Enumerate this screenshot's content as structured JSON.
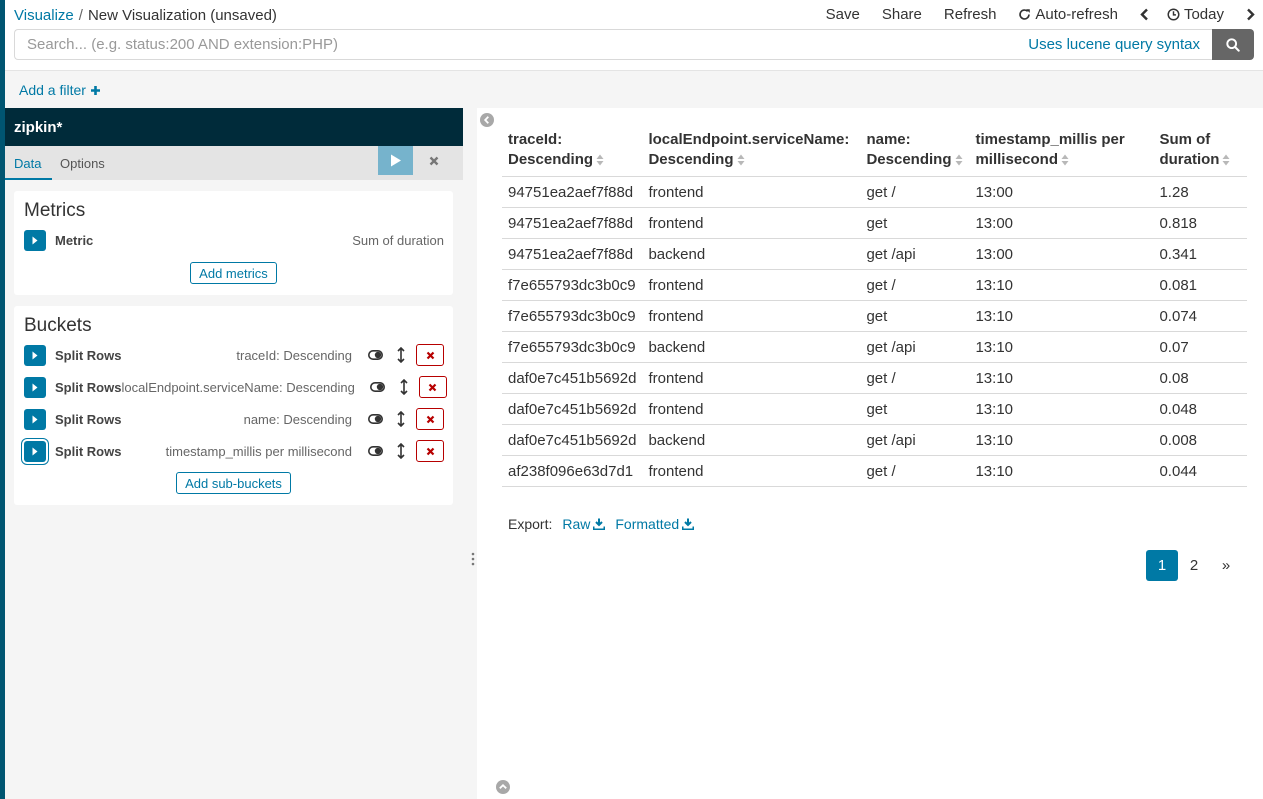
{
  "breadcrumb": {
    "root": "Visualize",
    "separator": "/",
    "current": "New Visualization (unsaved)"
  },
  "nav": {
    "save": "Save",
    "share": "Share",
    "refresh": "Refresh",
    "auto_refresh": "Auto-refresh",
    "time": "Today"
  },
  "search": {
    "placeholder": "Search... (e.g. status:200 AND extension:PHP)",
    "value": "",
    "lucene_link": "Uses lucene query syntax"
  },
  "filter": {
    "add_label": "Add a filter"
  },
  "index_pattern": "zipkin*",
  "tabs": {
    "data": "Data",
    "options": "Options"
  },
  "metrics": {
    "title": "Metrics",
    "items": [
      {
        "type": "Metric",
        "desc": "Sum of duration"
      }
    ],
    "add_label": "Add metrics"
  },
  "buckets": {
    "title": "Buckets",
    "items": [
      {
        "type": "Split Rows",
        "desc": "traceId: Descending"
      },
      {
        "type": "Split Rows",
        "desc": "localEndpoint.serviceName: Descending"
      },
      {
        "type": "Split Rows",
        "desc": "name: Descending"
      },
      {
        "type": "Split Rows",
        "desc": "timestamp_millis per millisecond"
      }
    ],
    "add_label": "Add sub-buckets"
  },
  "table": {
    "headers": [
      [
        "traceId:",
        "Descending"
      ],
      [
        "localEndpoint.serviceName:",
        "Descending"
      ],
      [
        "name:",
        "Descending"
      ],
      [
        "timestamp_millis per",
        "millisecond"
      ],
      [
        "Sum of",
        "duration"
      ]
    ],
    "rows": [
      [
        "94751ea2aef7f88d",
        "frontend",
        "get /",
        "13:00",
        "1.28"
      ],
      [
        "94751ea2aef7f88d",
        "frontend",
        "get",
        "13:00",
        "0.818"
      ],
      [
        "94751ea2aef7f88d",
        "backend",
        "get /api",
        "13:00",
        "0.341"
      ],
      [
        "f7e655793dc3b0c9",
        "frontend",
        "get /",
        "13:10",
        "0.081"
      ],
      [
        "f7e655793dc3b0c9",
        "frontend",
        "get",
        "13:10",
        "0.074"
      ],
      [
        "f7e655793dc3b0c9",
        "backend",
        "get /api",
        "13:10",
        "0.07"
      ],
      [
        "daf0e7c451b5692d",
        "frontend",
        "get /",
        "13:10",
        "0.08"
      ],
      [
        "daf0e7c451b5692d",
        "frontend",
        "get",
        "13:10",
        "0.048"
      ],
      [
        "daf0e7c451b5692d",
        "backend",
        "get /api",
        "13:10",
        "0.008"
      ],
      [
        "af238f096e63d7d1",
        "frontend",
        "get /",
        "13:10",
        "0.044"
      ]
    ]
  },
  "export": {
    "label": "Export:",
    "raw": "Raw",
    "formatted": "Formatted"
  },
  "pagination": {
    "pages": [
      "1",
      "2"
    ],
    "current": "1",
    "next": "»"
  },
  "colors": {
    "accent": "#0079a5",
    "header_dark": "#002b3a",
    "danger": "#b70000"
  }
}
